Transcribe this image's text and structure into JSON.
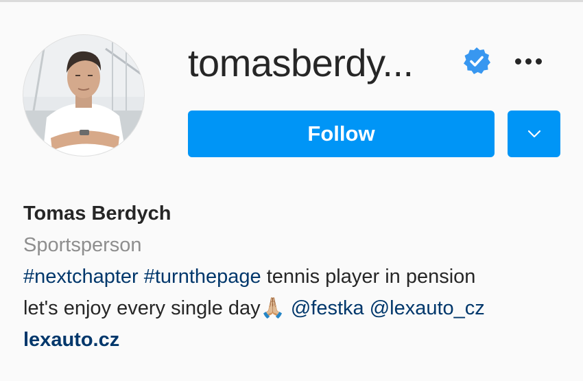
{
  "profile": {
    "username": "tomasberdy...",
    "full_name": "Tomas Berdych",
    "category": "Sportsperson",
    "verified_icon": "verified-badge-icon",
    "avatar_alt": "profile photo"
  },
  "actions": {
    "follow_label": "Follow",
    "dropdown_icon": "chevron-down-icon",
    "more_icon": "more-options-icon"
  },
  "bio": {
    "hashtag_1": "#nextchapter",
    "hashtag_2": "#turnthepage",
    "text_1": "tennis player in pension",
    "text_2": "let's enjoy every single day🙏🏼",
    "mention_1": "@festka",
    "mention_2": "@lexauto_cz",
    "website": "lexauto.cz"
  },
  "colors": {
    "accent": "#0095f6",
    "link": "#00376b",
    "verified": "#3897f0",
    "secondary_text": "#8e8e8e"
  }
}
